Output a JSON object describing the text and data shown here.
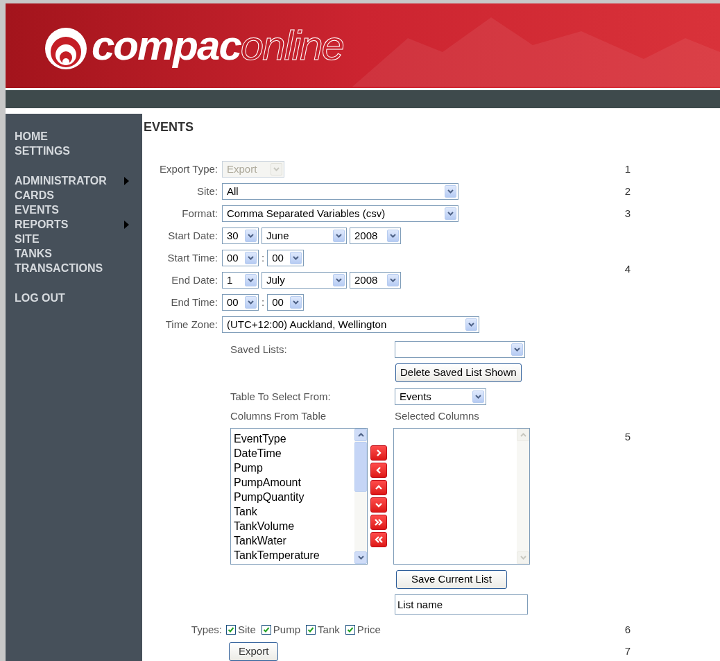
{
  "header": {
    "logo_bold": "compac",
    "logo_light": "online"
  },
  "sidebar": {
    "groups": [
      [
        {
          "label": "HOME",
          "has_submenu": false
        },
        {
          "label": "SETTINGS",
          "has_submenu": false
        }
      ],
      [
        {
          "label": "ADMINISTRATOR",
          "has_submenu": true
        },
        {
          "label": "CARDS",
          "has_submenu": false
        },
        {
          "label": "EVENTS",
          "has_submenu": false
        },
        {
          "label": "REPORTS",
          "has_submenu": true
        },
        {
          "label": "SITE",
          "has_submenu": false
        },
        {
          "label": "TANKS",
          "has_submenu": false
        },
        {
          "label": "TRANSACTIONS",
          "has_submenu": false
        }
      ],
      [
        {
          "label": "LOG OUT",
          "has_submenu": false
        }
      ]
    ]
  },
  "page_title": "EVENTS",
  "sections": [
    {
      "step": "1",
      "rows": [
        {
          "label": "Export Type:",
          "kind": "small",
          "disabled": true,
          "values": [
            "Export"
          ]
        }
      ]
    },
    {
      "step": "2",
      "rows": [
        {
          "label": "Site:",
          "kind": "wide",
          "disabled": false,
          "values": [
            "All"
          ]
        }
      ]
    },
    {
      "step": "3",
      "rows": [
        {
          "label": "Format:",
          "kind": "wide",
          "disabled": false,
          "values": [
            "Comma Separated Variables (csv)"
          ]
        }
      ]
    },
    {
      "step": "4",
      "rows": [
        {
          "label": "Start Date:",
          "kind": "date",
          "disabled": false,
          "values": [
            "30",
            "June",
            "2008"
          ]
        },
        {
          "label": "Start Time:",
          "kind": "time",
          "disabled": false,
          "values": [
            "00",
            "00"
          ],
          "separator": ":"
        },
        {
          "label": "End Date:",
          "kind": "date",
          "disabled": false,
          "values": [
            "1",
            "July",
            "2008"
          ]
        },
        {
          "label": "End Time:",
          "kind": "time",
          "disabled": false,
          "values": [
            "00",
            "00"
          ],
          "separator": ":"
        }
      ]
    },
    {
      "rows": [
        {
          "label": "Time Zone:",
          "kind": "zone",
          "disabled": false,
          "values": [
            "(UTC+12:00) Auckland, Wellington"
          ]
        }
      ]
    }
  ],
  "chooser": {
    "step": "5",
    "saved_lists": {
      "label": "Saved Lists:"
    },
    "delete_button": "Delete Saved List Shown",
    "table_select": {
      "label": "Table To Select From:",
      "value": "Events"
    },
    "available": {
      "label": "Columns From Table",
      "items": [
        "EventType",
        "DateTime",
        "Pump",
        "PumpAmount",
        "PumpQuantity",
        "Tank",
        "TankVolume",
        "TankWater",
        "TankTemperature"
      ]
    },
    "selected": {
      "label": "Selected Columns"
    },
    "move_buttons": [
      {
        "kind": "add"
      },
      {
        "kind": "remove"
      },
      {
        "kind": "up"
      },
      {
        "kind": "down"
      },
      {
        "kind": "add-all"
      },
      {
        "kind": "remove-all"
      }
    ],
    "save_button": "Save Current List",
    "list_name": {
      "value": "List name"
    }
  },
  "types": {
    "step": "6",
    "label": "Types:",
    "options": [
      {
        "label": "Site",
        "checked": true
      },
      {
        "label": "Pump",
        "checked": true
      },
      {
        "label": "Tank",
        "checked": true
      },
      {
        "label": "Price",
        "checked": true
      }
    ]
  },
  "export": {
    "step": "7",
    "label": "Export"
  }
}
